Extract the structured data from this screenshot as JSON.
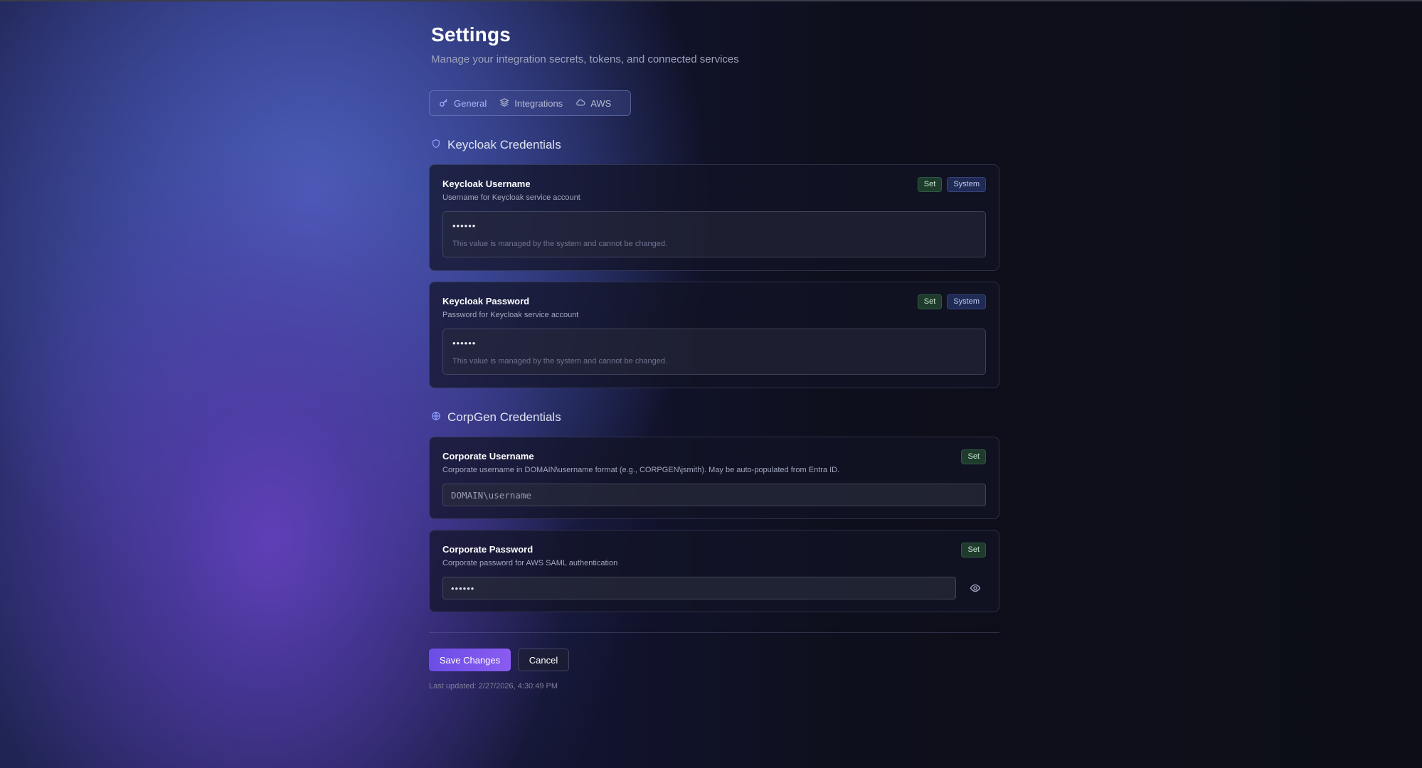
{
  "page": {
    "title": "Settings",
    "subtitle": "Manage your integration secrets, tokens, and connected services"
  },
  "tabs": [
    {
      "label": "General",
      "icon": "key-icon",
      "active": true
    },
    {
      "label": "Integrations",
      "icon": "layers-icon",
      "active": false
    },
    {
      "label": "AWS",
      "icon": "cloud-icon",
      "active": false
    }
  ],
  "sections": {
    "keycloak": {
      "title": "Keycloak Credentials",
      "icon": "shield-icon",
      "fields": [
        {
          "label": "Keycloak Username",
          "description": "Username for Keycloak service account",
          "badges": [
            "Set",
            "System"
          ],
          "value": "••••••",
          "note": "This value is managed by the system and cannot be changed."
        },
        {
          "label": "Keycloak Password",
          "description": "Password for Keycloak service account",
          "badges": [
            "Set",
            "System"
          ],
          "value": "••••••",
          "note": "This value is managed by the system and cannot be changed."
        }
      ]
    },
    "corpgen": {
      "title": "CorpGen Credentials",
      "icon": "globe-icon",
      "fields": [
        {
          "label": "Corporate Username",
          "description": "Corporate username in DOMAIN\\username format (e.g., CORPGEN\\jsmith). May be auto-populated from Entra ID.",
          "badges": [
            "Set"
          ],
          "placeholder": "DOMAIN\\username"
        },
        {
          "label": "Corporate Password",
          "description": "Corporate password for AWS SAML authentication",
          "badges": [
            "Set"
          ],
          "value": "••••••",
          "icon": "eye-icon"
        }
      ]
    }
  },
  "actions": {
    "save_label": "Save Changes",
    "cancel_label": "Cancel"
  },
  "footer": {
    "last_updated": "Last updated: 2/27/2026, 4:30:49 PM"
  },
  "colors": {
    "accent": "#7b55ec",
    "badge_set": "#1e3b2c",
    "badge_system": "#1f2a55"
  }
}
